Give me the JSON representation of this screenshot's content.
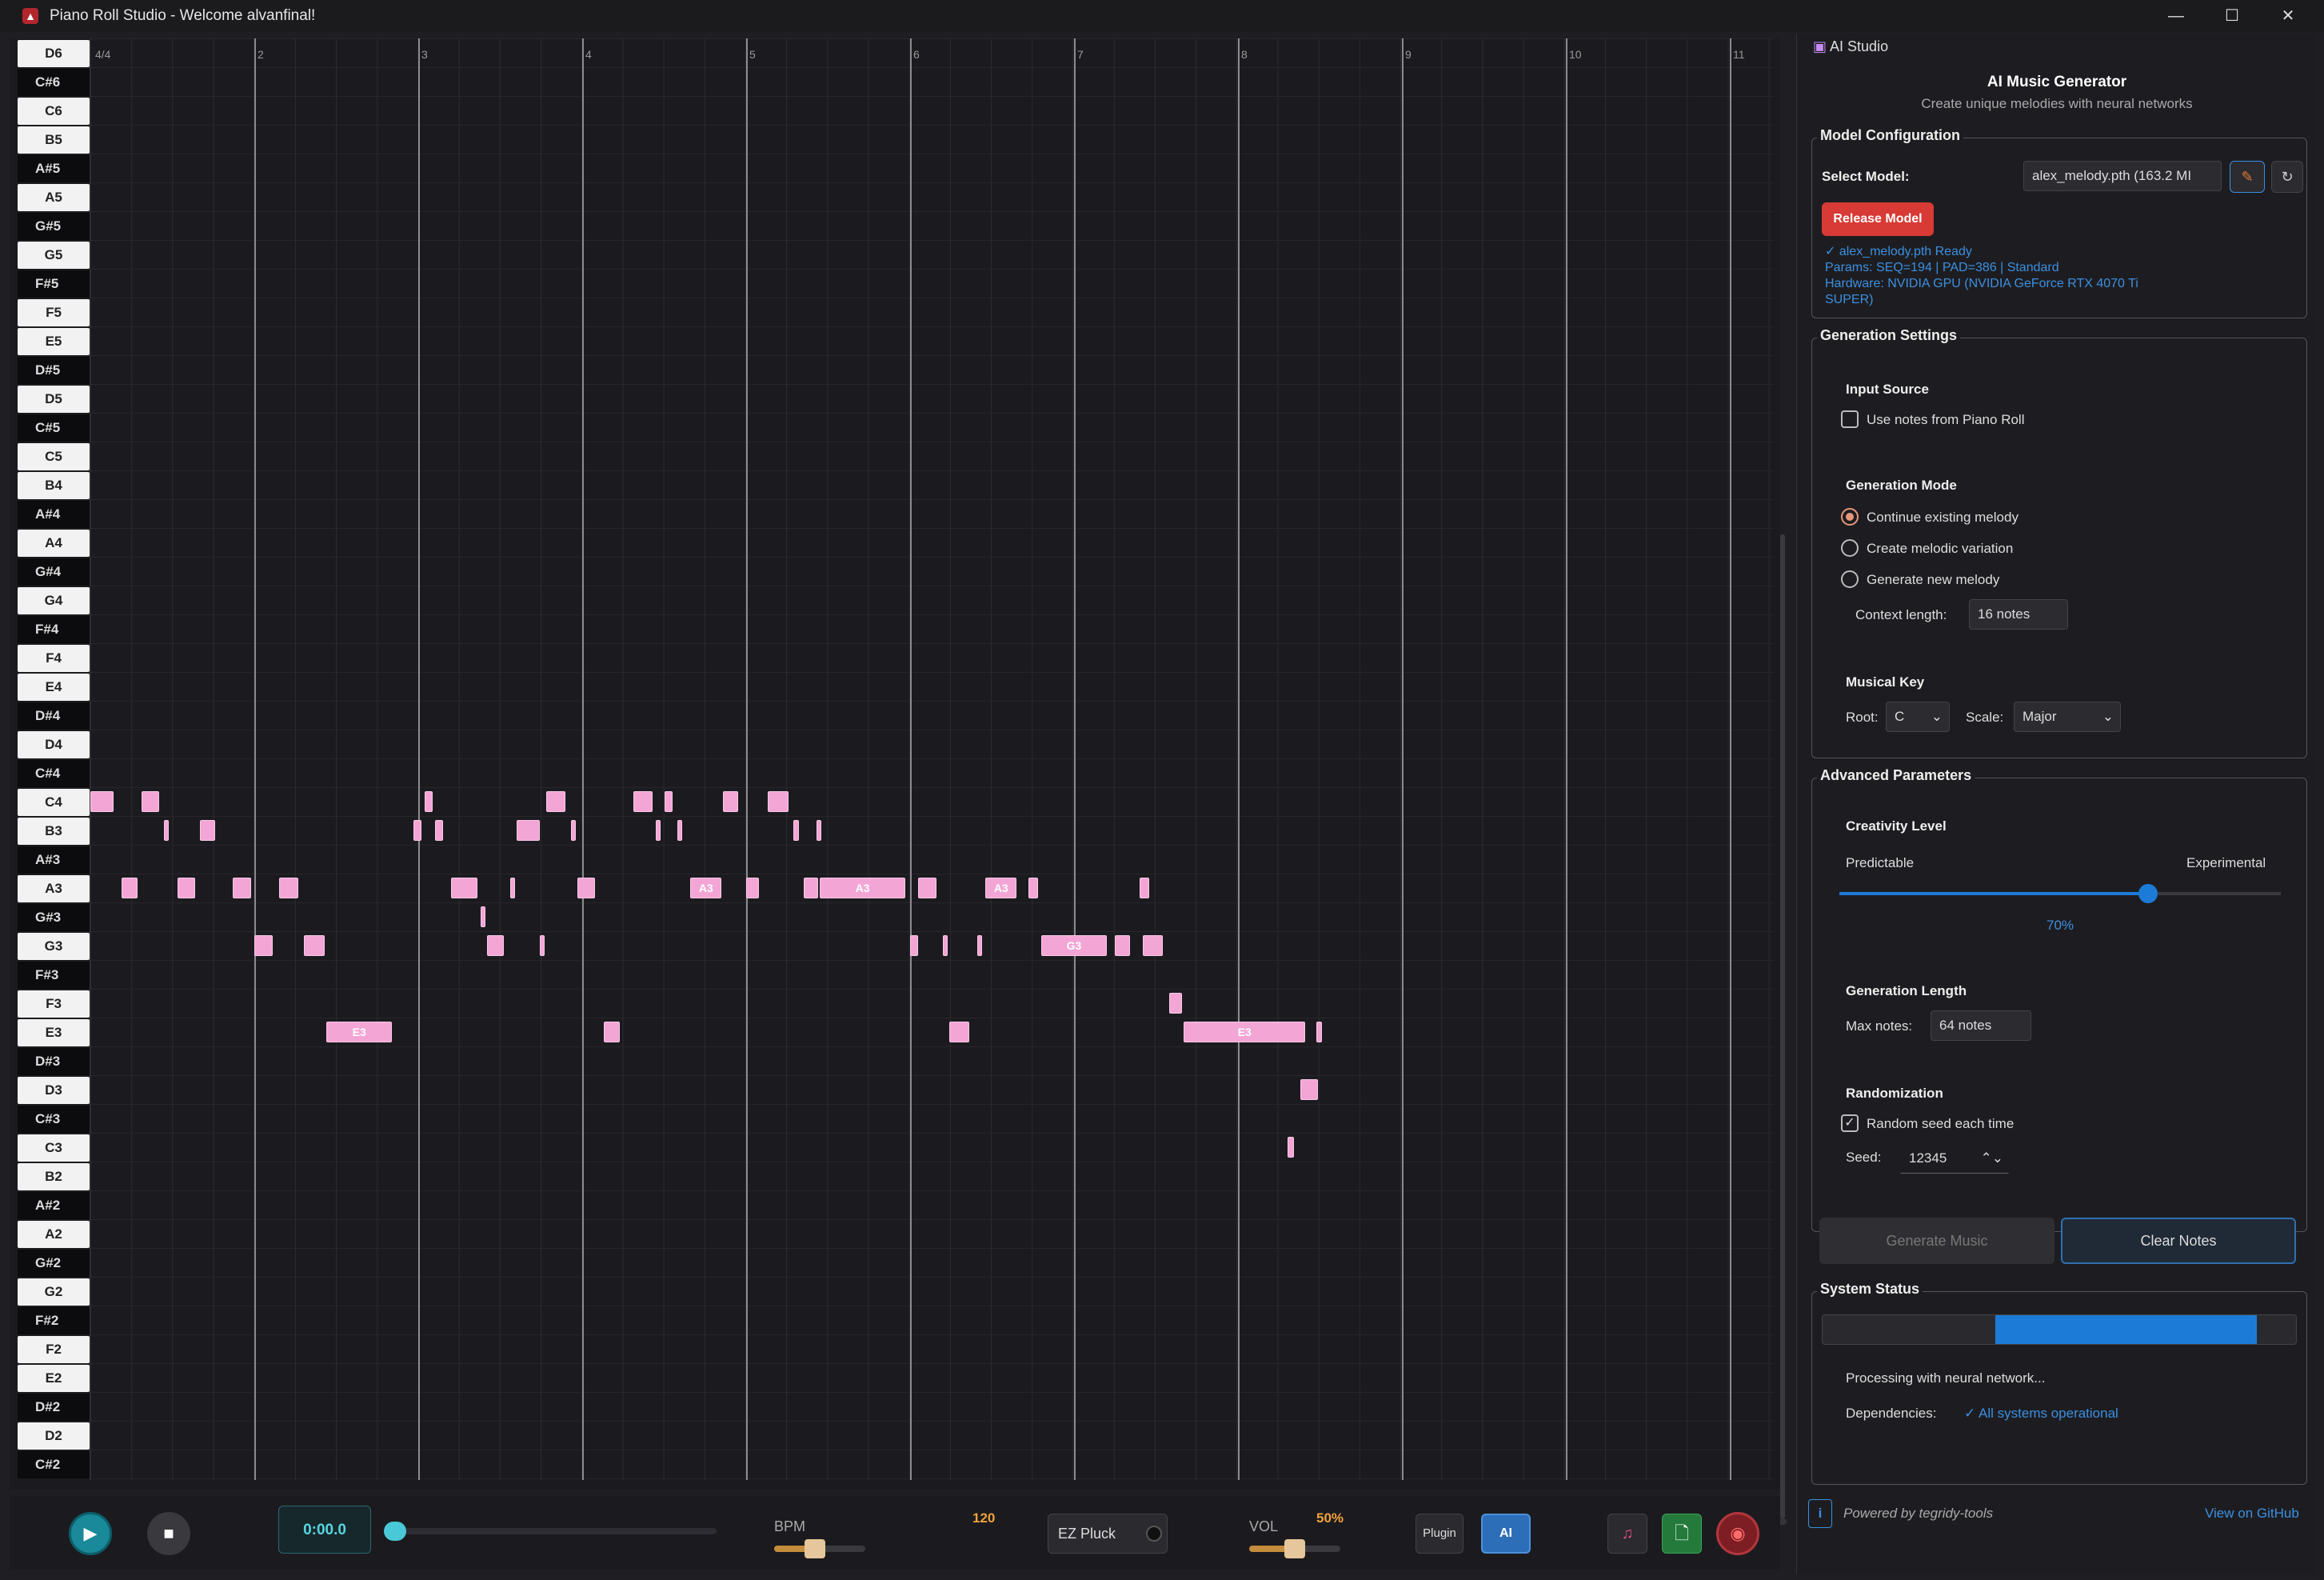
{
  "window": {
    "title": "Piano Roll Studio - Welcome alvanfinal!",
    "app_icon": "triangle-logo-icon"
  },
  "piano_roll": {
    "time_signature": "4/4",
    "bars": [
      "2",
      "3",
      "4",
      "5",
      "6",
      "7",
      "8",
      "9",
      "10",
      "11"
    ],
    "keys": [
      {
        "label": "D6",
        "color": "white"
      },
      {
        "label": "C#6",
        "color": "black"
      },
      {
        "label": "C6",
        "color": "white"
      },
      {
        "label": "B5",
        "color": "white"
      },
      {
        "label": "A#5",
        "color": "black"
      },
      {
        "label": "A5",
        "color": "white"
      },
      {
        "label": "G#5",
        "color": "black"
      },
      {
        "label": "G5",
        "color": "white"
      },
      {
        "label": "F#5",
        "color": "black"
      },
      {
        "label": "F5",
        "color": "white"
      },
      {
        "label": "E5",
        "color": "white"
      },
      {
        "label": "D#5",
        "color": "black"
      },
      {
        "label": "D5",
        "color": "white"
      },
      {
        "label": "C#5",
        "color": "black"
      },
      {
        "label": "C5",
        "color": "white"
      },
      {
        "label": "B4",
        "color": "white"
      },
      {
        "label": "A#4",
        "color": "black"
      },
      {
        "label": "A4",
        "color": "white"
      },
      {
        "label": "G#4",
        "color": "black"
      },
      {
        "label": "G4",
        "color": "white"
      },
      {
        "label": "F#4",
        "color": "black"
      },
      {
        "label": "F4",
        "color": "white"
      },
      {
        "label": "E4",
        "color": "white"
      },
      {
        "label": "D#4",
        "color": "black"
      },
      {
        "label": "D4",
        "color": "white"
      },
      {
        "label": "C#4",
        "color": "black"
      },
      {
        "label": "C4",
        "color": "white"
      },
      {
        "label": "B3",
        "color": "white"
      },
      {
        "label": "A#3",
        "color": "black"
      },
      {
        "label": "A3",
        "color": "white"
      },
      {
        "label": "G#3",
        "color": "black"
      },
      {
        "label": "G3",
        "color": "white"
      },
      {
        "label": "F#3",
        "color": "black"
      },
      {
        "label": "F3",
        "color": "white"
      },
      {
        "label": "E3",
        "color": "white"
      },
      {
        "label": "D#3",
        "color": "black"
      },
      {
        "label": "D3",
        "color": "white"
      },
      {
        "label": "C#3",
        "color": "black"
      },
      {
        "label": "C3",
        "color": "white"
      },
      {
        "label": "B2",
        "color": "white"
      },
      {
        "label": "A#2",
        "color": "black"
      },
      {
        "label": "A2",
        "color": "white"
      },
      {
        "label": "G#2",
        "color": "black"
      },
      {
        "label": "G2",
        "color": "white"
      },
      {
        "label": "F#2",
        "color": "black"
      },
      {
        "label": "F2",
        "color": "white"
      },
      {
        "label": "E2",
        "color": "white"
      },
      {
        "label": "D#2",
        "color": "black"
      },
      {
        "label": "D2",
        "color": "white"
      },
      {
        "label": "C#2",
        "color": "black"
      }
    ],
    "notes": [
      {
        "pitch": "C4",
        "start": 1.0,
        "dur": 0.14
      },
      {
        "pitch": "C4",
        "start": 1.31,
        "dur": 0.11
      },
      {
        "pitch": "B3",
        "start": 1.45,
        "dur": 0.02
      },
      {
        "pitch": "B3",
        "start": 1.67,
        "dur": 0.09
      },
      {
        "pitch": "A3",
        "start": 1.19,
        "dur": 0.1
      },
      {
        "pitch": "A3",
        "start": 1.53,
        "dur": 0.11
      },
      {
        "pitch": "A3",
        "start": 1.87,
        "dur": 0.11
      },
      {
        "pitch": "A3",
        "start": 2.15,
        "dur": 0.12
      },
      {
        "pitch": "G3",
        "start": 2.0,
        "dur": 0.11
      },
      {
        "pitch": "G3",
        "start": 2.3,
        "dur": 0.13
      },
      {
        "pitch": "E3",
        "start": 2.44,
        "dur": 0.4,
        "label": "E3"
      },
      {
        "pitch": "C4",
        "start": 3.04,
        "dur": 0.05
      },
      {
        "pitch": "B3",
        "start": 2.97,
        "dur": 0.05
      },
      {
        "pitch": "B3",
        "start": 3.1,
        "dur": 0.05
      },
      {
        "pitch": "A3",
        "start": 3.2,
        "dur": 0.16
      },
      {
        "pitch": "G#3",
        "start": 3.38,
        "dur": 0.02
      },
      {
        "pitch": "G3",
        "start": 3.42,
        "dur": 0.1
      },
      {
        "pitch": "A3",
        "start": 3.56,
        "dur": 0.02
      },
      {
        "pitch": "B3",
        "start": 3.6,
        "dur": 0.14
      },
      {
        "pitch": "G3",
        "start": 3.74,
        "dur": 0.02
      },
      {
        "pitch": "C4",
        "start": 3.78,
        "dur": 0.12
      },
      {
        "pitch": "B3",
        "start": 3.93,
        "dur": 0.02
      },
      {
        "pitch": "A3",
        "start": 3.97,
        "dur": 0.11
      },
      {
        "pitch": "E3",
        "start": 4.13,
        "dur": 0.1
      },
      {
        "pitch": "C4",
        "start": 4.31,
        "dur": 0.12
      },
      {
        "pitch": "B3",
        "start": 4.45,
        "dur": 0.03
      },
      {
        "pitch": "C4",
        "start": 4.5,
        "dur": 0.05
      },
      {
        "pitch": "B3",
        "start": 4.58,
        "dur": 0.03
      },
      {
        "pitch": "A3",
        "start": 4.66,
        "dur": 0.19,
        "label": "A3"
      },
      {
        "pitch": "C4",
        "start": 4.86,
        "dur": 0.09
      },
      {
        "pitch": "A3",
        "start": 5.0,
        "dur": 0.08
      },
      {
        "pitch": "C4",
        "start": 5.13,
        "dur": 0.13
      },
      {
        "pitch": "B3",
        "start": 5.29,
        "dur": 0.03
      },
      {
        "pitch": "A3",
        "start": 5.35,
        "dur": 0.09
      },
      {
        "pitch": "B3",
        "start": 5.43,
        "dur": 0.03
      },
      {
        "pitch": "A3",
        "start": 5.45,
        "dur": 0.52,
        "label": "A3"
      },
      {
        "pitch": "A3",
        "start": 6.05,
        "dur": 0.11
      },
      {
        "pitch": "G3",
        "start": 6.0,
        "dur": 0.05
      },
      {
        "pitch": "G3",
        "start": 6.2,
        "dur": 0.03
      },
      {
        "pitch": "E3",
        "start": 6.24,
        "dur": 0.12
      },
      {
        "pitch": "G3",
        "start": 6.41,
        "dur": 0.02
      },
      {
        "pitch": "A3",
        "start": 6.46,
        "dur": 0.19,
        "label": "A3"
      },
      {
        "pitch": "A3",
        "start": 6.72,
        "dur": 0.06
      },
      {
        "pitch": "G3",
        "start": 6.8,
        "dur": 0.4,
        "label": "G3"
      },
      {
        "pitch": "G3",
        "start": 7.25,
        "dur": 0.09
      },
      {
        "pitch": "A3",
        "start": 7.4,
        "dur": 0.06
      },
      {
        "pitch": "G3",
        "start": 7.42,
        "dur": 0.12
      },
      {
        "pitch": "F3",
        "start": 7.58,
        "dur": 0.08
      },
      {
        "pitch": "E3",
        "start": 7.67,
        "dur": 0.74,
        "label": "E3"
      },
      {
        "pitch": "E3",
        "start": 8.48,
        "dur": 0.03
      },
      {
        "pitch": "D3",
        "start": 8.38,
        "dur": 0.11
      },
      {
        "pitch": "C3",
        "start": 8.3,
        "dur": 0.04
      }
    ]
  },
  "transport": {
    "time": "0:00.0",
    "bpm_label": "BPM",
    "bpm_value": "120",
    "instrument": "EZ Pluck",
    "vol_label": "VOL",
    "vol_value": "50%",
    "plugin_label": "Plugin",
    "ai_label": "AI",
    "bpm_level": 0.45,
    "vol_level": 0.5,
    "position_level": 0.0
  },
  "ai_panel": {
    "tab_title": "AI Studio",
    "heading": "AI Music Generator",
    "subheading": "Create unique melodies with neural networks",
    "model_config": {
      "title": "Model Configuration",
      "select_label": "Select Model:",
      "model_value": "alex_melody.pth (163.2 MI",
      "release_label": "Release Model",
      "status_ready": "✓ alex_melody.pth Ready",
      "status_params": "Params: SEQ=194 | PAD=386 | Standard",
      "status_hardware": "Hardware: NVIDIA GPU (NVIDIA GeForce RTX 4070 Ti SUPER)"
    },
    "generation": {
      "title": "Generation Settings",
      "input_source": "Input Source",
      "use_notes": "Use notes from Piano Roll",
      "mode_title": "Generation Mode",
      "modes": [
        "Continue existing melody",
        "Create melodic variation",
        "Generate new melody"
      ],
      "context_label": "Context length:",
      "context_value": "16 notes",
      "key_title": "Musical Key",
      "root_label": "Root:",
      "root_value": "C",
      "scale_label": "Scale:",
      "scale_value": "Major"
    },
    "advanced": {
      "title": "Advanced Parameters",
      "creativity_title": "Creativity Level",
      "predictable": "Predictable",
      "experimental": "Experimental",
      "creativity_value": "70%",
      "creativity_level": 0.7,
      "length_title": "Generation Length",
      "max_notes_label": "Max notes:",
      "max_notes_value": "64 notes",
      "random_title": "Randomization",
      "random_seed": "Random seed each time",
      "seed_label": "Seed:",
      "seed_value": "12345"
    },
    "actions": {
      "generate": "Generate Music",
      "clear": "Clear Notes"
    },
    "status": {
      "title": "System Status",
      "progress": 0.55,
      "processing": "Processing with neural network...",
      "deps_label": "Dependencies:",
      "deps_value": "✓ All systems operational"
    },
    "footer": {
      "powered": "Powered by tegridy-tools",
      "github": "View on GitHub"
    }
  },
  "colors": {
    "note": "#f3a6d6",
    "accent": "#1c7bd6",
    "danger": "#d83a35",
    "link": "#3c8fe0"
  }
}
